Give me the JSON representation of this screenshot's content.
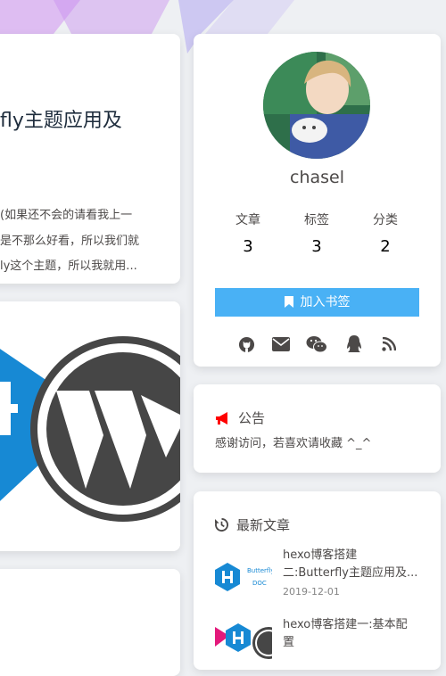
{
  "posts": [
    {
      "title_fragment": "fly主题应用及",
      "excerpt": [
        "(如果还不会的请看我上一",
        "是不那么好看，所以我们就",
        "ly这个主题，所以我就用..."
      ]
    }
  ],
  "author": {
    "name": "chasel",
    "stats": [
      {
        "label": "文章",
        "value": "3"
      },
      {
        "label": "标签",
        "value": "3"
      },
      {
        "label": "分类",
        "value": "2"
      }
    ],
    "bookmark_label": "加入书签",
    "social_icons": [
      "github-icon",
      "email-icon",
      "wechat-icon",
      "qq-icon",
      "rss-icon"
    ]
  },
  "announcement": {
    "title": "公告",
    "text": "感谢访问，若喜欢请收藏 ^_^"
  },
  "recent": {
    "title": "最新文章",
    "items": [
      {
        "title_lines": [
          "hexo博客搭建",
          "二:Butterfly主题应用及..."
        ],
        "date": "2019-12-01"
      },
      {
        "title_lines": [
          "hexo博客搭建一:基本配",
          "置"
        ],
        "date": ""
      }
    ]
  },
  "colors": {
    "accent": "#49b1f5",
    "announce_icon": "#ff0000"
  }
}
